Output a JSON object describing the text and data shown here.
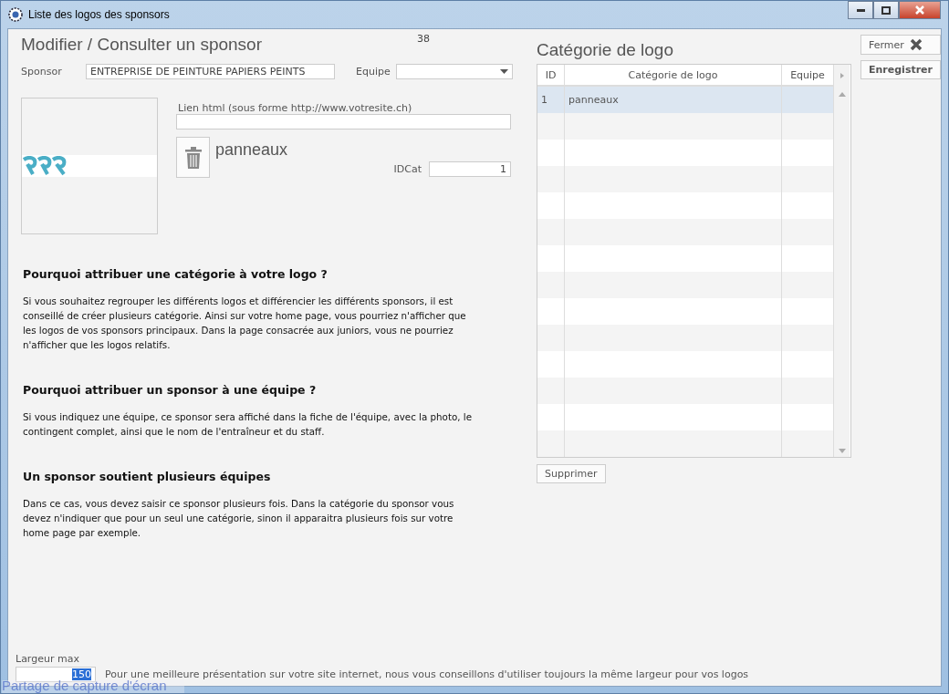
{
  "window": {
    "title": "Liste des logos des sponsors"
  },
  "form": {
    "title": "Modifier / Consulter un sponsor",
    "record_number": "38",
    "sponsor": {
      "label": "Sponsor",
      "value": "ENTREPRISE DE PEINTURE PAPIERS PEINTS"
    },
    "equipe": {
      "label": "Equipe"
    },
    "link": {
      "label": "Lien html (sous forme http://www.votresite.ch)"
    },
    "category_name": "panneaux",
    "idcat": {
      "label": "IDCat",
      "value": "1"
    }
  },
  "help": [
    {
      "heading": "Pourquoi attribuer une catégorie à votre logo ?",
      "text": "Si vous souhaitez regrouper les différents logos et différencier les différents sponsors, il est conseillé de créer plusieurs catégorie. Ainsi sur votre home page, vous pourriez n'afficher que les logos de vos sponsors principaux. Dans la page consacrée aux juniors, vous ne pourriez n'afficher que les logos relatifs."
    },
    {
      "heading": "Pourquoi attribuer un sponsor à une équipe ?",
      "text": "Si vous indiquez une équipe, ce sponsor sera affiché dans la fiche de l'équipe, avec la photo, le contingent complet, ainsi que le nom de l'entraîneur et du staff."
    },
    {
      "heading": "Un sponsor soutient plusieurs équipes",
      "text": "Dans ce cas, vous devez saisir ce sponsor plusieurs fois. Dans la catégorie du sponsor vous devez n'indiquer que pour un seul une catégorie, sinon il apparaitra plusieurs fois sur votre home page par exemple."
    }
  ],
  "category_table": {
    "title": "Catégorie de logo",
    "columns": [
      "ID",
      "Catégorie de logo",
      "Equipe"
    ],
    "rows": [
      {
        "id": "1",
        "name": "panneaux",
        "selected": true
      }
    ],
    "delete_button": "Supprimer"
  },
  "buttons": {
    "close": "Fermer",
    "save": "Enregistrer"
  },
  "width": {
    "label": "Largeur max",
    "value": "150",
    "hint": "Pour une meilleure présentation sur votre site internet, nous vous conseillons d'utiliser toujours la même largeur pour vos logos"
  },
  "overlay": {
    "text": "Partage de capture d'écran"
  }
}
